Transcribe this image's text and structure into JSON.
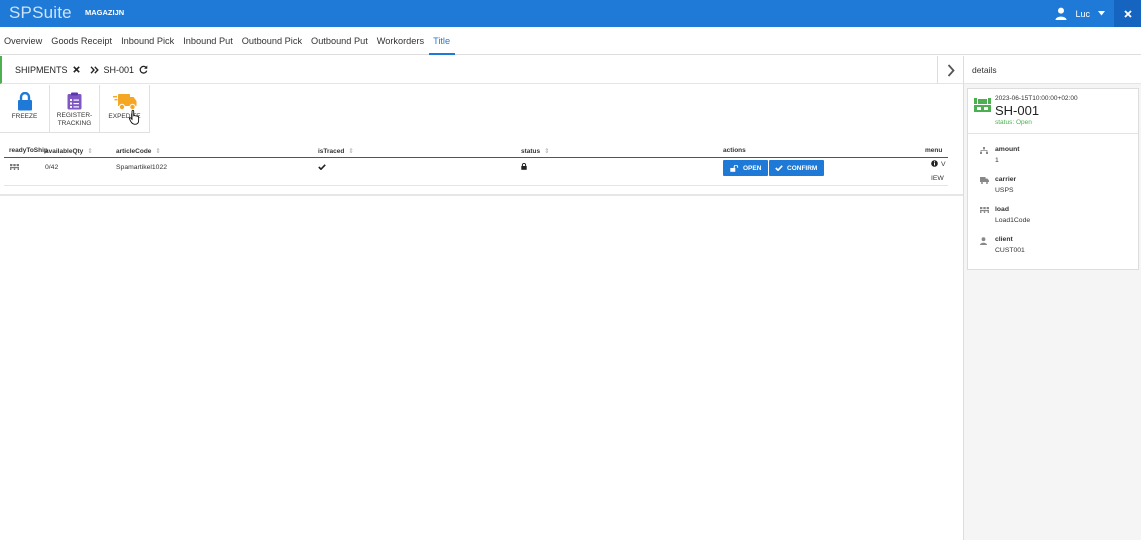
{
  "topbar": {
    "brand": "SPSuite",
    "module": "MAGAZIJN",
    "user": "Luc"
  },
  "nav": [
    "Overview",
    "Goods Receipt",
    "Inbound Pick",
    "Inbound Put",
    "Outbound Pick",
    "Outbound Put",
    "Workorders",
    "Title"
  ],
  "breadcrumb": {
    "root": "SHIPMENTS",
    "current": "SH-001"
  },
  "toolbar": {
    "freeze": "FREEZE",
    "register_line1": "REGISTER-",
    "register_line2": "TRACKING",
    "expedite": "EXPEDITE"
  },
  "table": {
    "headers": [
      "readyToShip",
      "availableQty",
      "articleCode",
      "isTraced",
      "status",
      "actions",
      "menu"
    ],
    "rows": [
      {
        "availableQty": "0/42",
        "articleCode": "Spamartikel1022",
        "open_label": "OPEN",
        "confirm_label": "CONFIRM",
        "menu_line1": "V",
        "menu_line2": "IEW"
      }
    ]
  },
  "details": {
    "title": "details",
    "datetime": "2023-06-15T10:00:00+02:00",
    "id": "SH-001",
    "status": "status: Open",
    "fields": [
      {
        "key": "amount",
        "value": "1"
      },
      {
        "key": "carrier",
        "value": "USPS"
      },
      {
        "key": "load",
        "value": "Load1Code"
      },
      {
        "key": "client",
        "value": "CUST001"
      }
    ]
  },
  "colors": {
    "primary": "#1e7ad6",
    "success": "#4caf50",
    "expedite": "#f5a623",
    "register": "#7e57c2"
  }
}
